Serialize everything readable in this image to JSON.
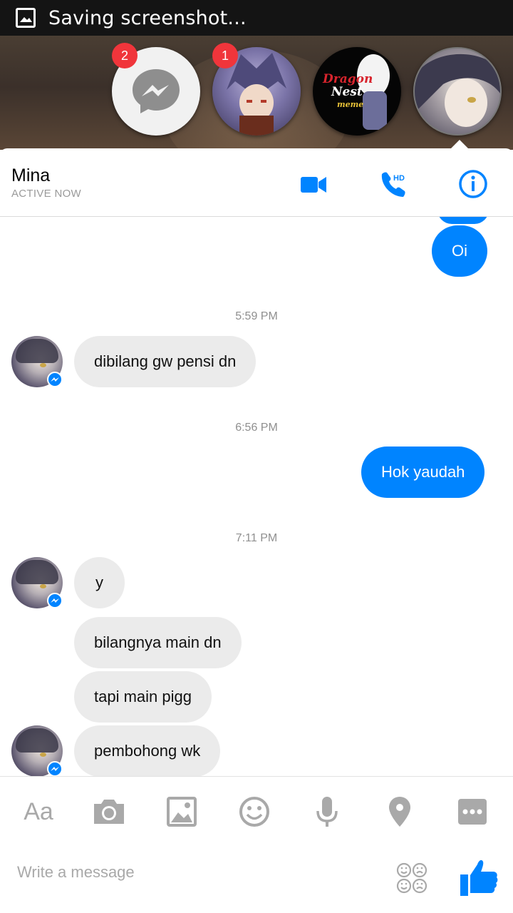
{
  "status_bar": {
    "notification_text": "Saving screenshot..."
  },
  "chat_heads": [
    {
      "name": "messenger",
      "badge": "2"
    },
    {
      "name": "contact-1",
      "badge": "1"
    },
    {
      "name": "dragon-nest-meme",
      "label_line1": "Dragon",
      "label_line2": "Nest",
      "label_line3": "meme"
    },
    {
      "name": "mina-active"
    }
  ],
  "header": {
    "contact_name": "Mina",
    "presence": "ACTIVE NOW"
  },
  "messages": [
    {
      "type": "out",
      "text": "Oi"
    },
    {
      "type": "time",
      "text": "5:59 PM"
    },
    {
      "type": "in",
      "text": "dibilang gw pensi dn"
    },
    {
      "type": "time",
      "text": "6:56 PM"
    },
    {
      "type": "out",
      "text": "Hok yaudah"
    },
    {
      "type": "time",
      "text": "7:11 PM"
    },
    {
      "type": "in",
      "text": "y"
    },
    {
      "type": "in",
      "text": "bilangnya main dn"
    },
    {
      "type": "in",
      "text": "tapi main pigg"
    },
    {
      "type": "in",
      "text": "pembohong wk"
    }
  ],
  "toolbar": {
    "text_format_label": "Aa"
  },
  "composer": {
    "placeholder": "Write a message"
  },
  "colors": {
    "accent": "#0084ff",
    "incoming_bubble": "#ebebeb",
    "badge": "#f0353b"
  }
}
